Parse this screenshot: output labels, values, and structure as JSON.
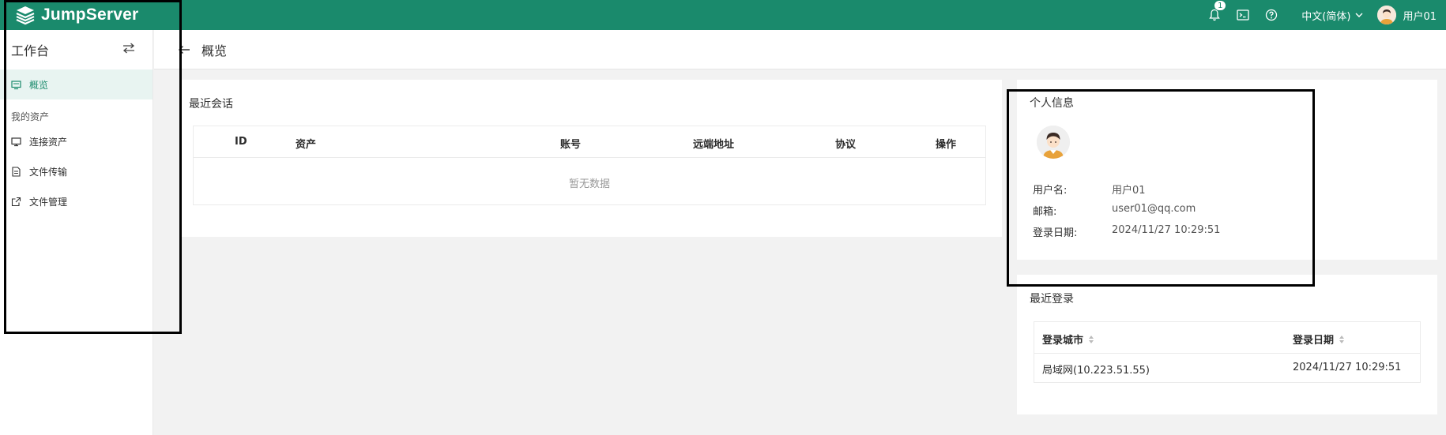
{
  "app": {
    "brand": "JumpServer"
  },
  "topbar": {
    "notification_count": "1",
    "language": "中文(简体)",
    "user_name": "用户01"
  },
  "sidebar": {
    "title": "工作台",
    "items": [
      {
        "label": "概览",
        "icon": "monitor-icon",
        "active": true
      }
    ],
    "group_label": "我的资产",
    "group_items": [
      {
        "label": "连接资产",
        "icon": "desktop-icon"
      },
      {
        "label": "文件传输",
        "icon": "file-icon"
      },
      {
        "label": "文件管理",
        "icon": "external-link-icon"
      }
    ]
  },
  "page": {
    "title": "概览"
  },
  "recent_sessions": {
    "title": "最近会话",
    "columns": [
      "ID",
      "资产",
      "账号",
      "远端地址",
      "协议",
      "操作"
    ],
    "empty_text": "暂无数据"
  },
  "profile": {
    "title": "个人信息",
    "username_label": "用户名:",
    "username": "用户01",
    "email_label": "邮箱:",
    "email": "user01@qq.com",
    "login_date_label": "登录日期:",
    "login_date": "2024/11/27 10:29:51"
  },
  "recent_logins": {
    "title": "最近登录",
    "columns": [
      "登录城市",
      "登录日期"
    ],
    "rows": [
      {
        "city": "局域网(10.223.51.55)",
        "date": "2024/11/27 10:29:51"
      }
    ]
  },
  "colors": {
    "brand": "#1a8a6c",
    "active_bg": "#e8f4f1",
    "page_bg": "#f2f2f2"
  }
}
